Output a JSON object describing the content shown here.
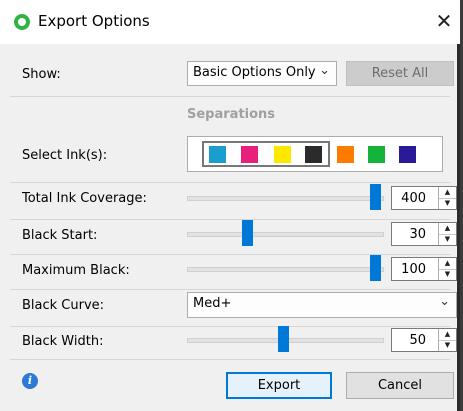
{
  "dialog": {
    "title": "Export Options",
    "close_glyph": "✕"
  },
  "show": {
    "label": "Show:",
    "selected": "Basic Options Only",
    "reset_label": "Reset All"
  },
  "separations": {
    "heading": "Separations",
    "select_inks_label": "Select Ink(s):",
    "inks": [
      {
        "name": "cyan",
        "color": "#1a9ecf"
      },
      {
        "name": "magenta",
        "color": "#e8207c"
      },
      {
        "name": "yellow",
        "color": "#ffe800"
      },
      {
        "name": "black",
        "color": "#2b2b2b"
      },
      {
        "name": "orange",
        "color": "#ff7a00"
      },
      {
        "name": "green",
        "color": "#15b33a"
      },
      {
        "name": "violet",
        "color": "#2a1a9a"
      }
    ]
  },
  "controls": {
    "total_ink": {
      "label": "Total Ink Coverage:",
      "value": "400",
      "slider_fraction": 1.0
    },
    "black_start": {
      "label": "Black Start:",
      "value": "30",
      "slider_fraction": 0.3
    },
    "maximum_black": {
      "label": "Maximum Black:",
      "value": "100",
      "slider_fraction": 1.0
    },
    "black_curve": {
      "label": "Black Curve:",
      "selected": "Med+"
    },
    "black_width": {
      "label": "Black Width:",
      "value": "50",
      "slider_fraction": 0.5
    }
  },
  "footer": {
    "info_glyph": "i",
    "export_label": "Export",
    "cancel_label": "Cancel"
  },
  "colors": {
    "accent": "#0078d7",
    "app_icon": "#2fb344"
  }
}
